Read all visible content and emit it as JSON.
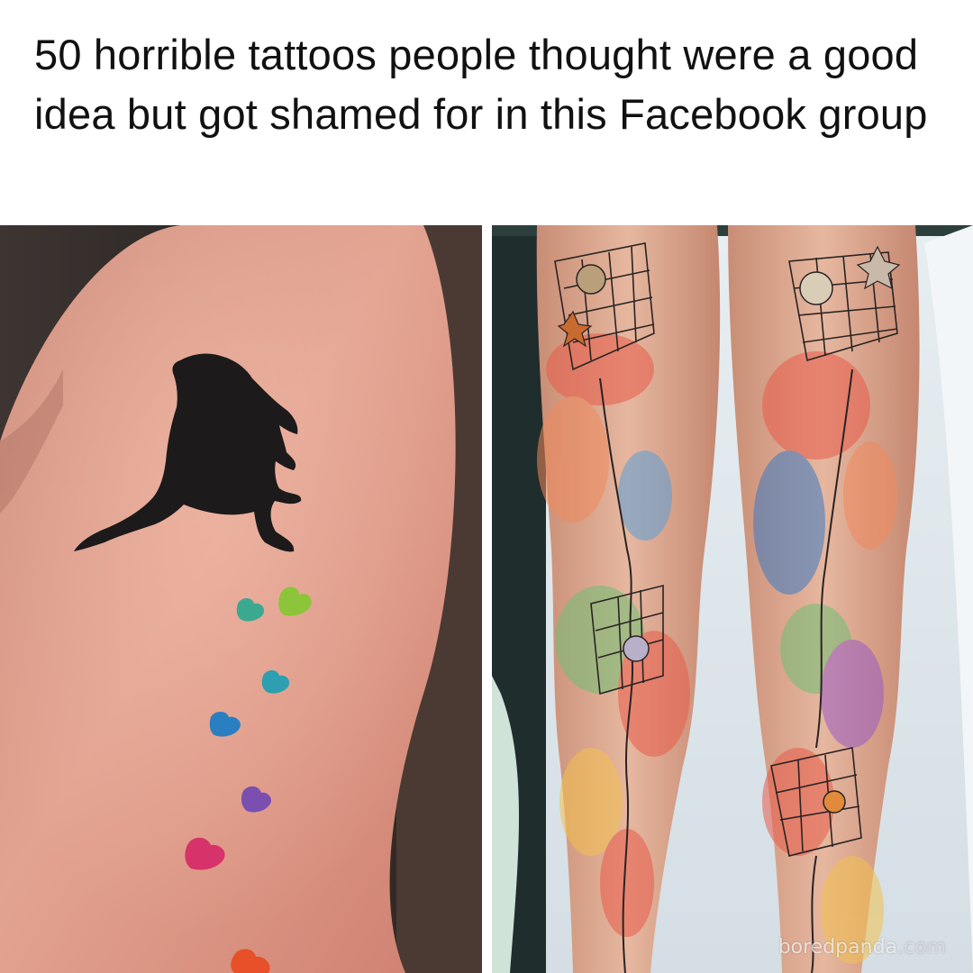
{
  "caption": {
    "title": "50 horrible tattoos people thought were a good idea but got shamed for in this Facebook group"
  },
  "photos": [
    {
      "subject": "dog-silhouette-with-rainbow-paw-prints"
    },
    {
      "subject": "watercolor-ocean-net-leg-tattoos"
    }
  ],
  "watermark": {
    "brand": "boredpanda",
    "suffix": ".com"
  }
}
